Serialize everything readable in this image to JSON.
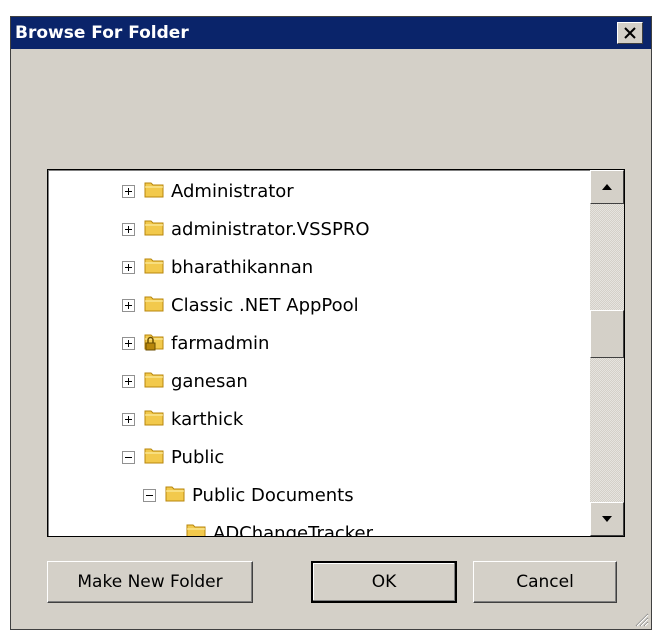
{
  "dialog": {
    "title": "Browse For Folder",
    "close_glyph": "✕"
  },
  "tree": {
    "items": [
      {
        "label": "Administrator",
        "expander": "plus",
        "icon": "folder-icon",
        "depth": 0
      },
      {
        "label": "administrator.VSSPRO",
        "expander": "plus",
        "icon": "folder-icon",
        "depth": 0
      },
      {
        "label": "bharathikannan",
        "expander": "plus",
        "icon": "folder-icon",
        "depth": 0
      },
      {
        "label": "Classic .NET AppPool",
        "expander": "plus",
        "icon": "folder-icon",
        "depth": 0
      },
      {
        "label": "farmadmin",
        "expander": "plus",
        "icon": "locked-folder-icon",
        "depth": 0
      },
      {
        "label": "ganesan",
        "expander": "plus",
        "icon": "folder-icon",
        "depth": 0
      },
      {
        "label": "karthick",
        "expander": "plus",
        "icon": "folder-icon",
        "depth": 0
      },
      {
        "label": "Public",
        "expander": "minus",
        "icon": "folder-icon",
        "depth": 0
      },
      {
        "label": "Public Documents",
        "expander": "minus",
        "icon": "folder-icon",
        "depth": 1
      },
      {
        "label": "ADChangeTracker",
        "expander": "none",
        "icon": "folder-icon",
        "depth": 2
      }
    ]
  },
  "buttons": {
    "make_new_folder": "Make New Folder",
    "ok": "OK",
    "cancel": "Cancel"
  },
  "colors": {
    "titlebar": "#0a246a",
    "window": "#d4d0c8",
    "folder": "#f2c94c"
  }
}
